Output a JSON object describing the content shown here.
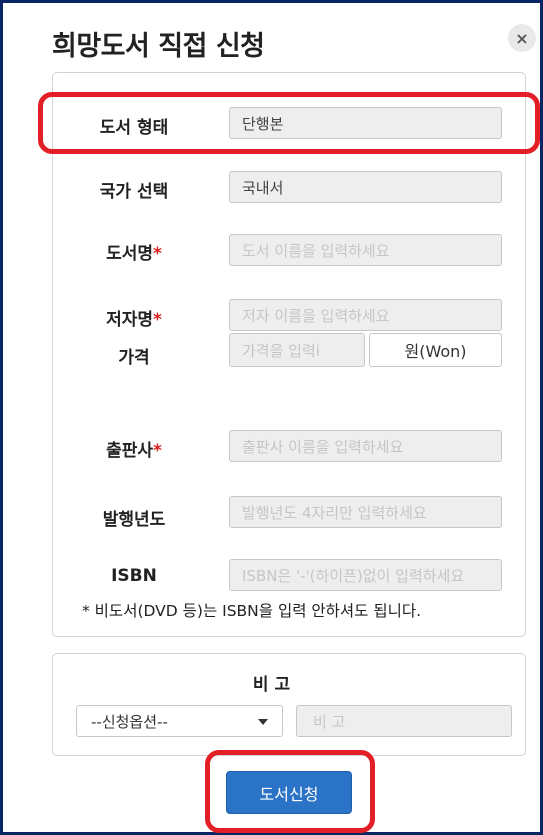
{
  "dialog": {
    "title": "희망도서 직접 신청",
    "close_label": "×"
  },
  "form": {
    "rows": [
      {
        "label": "도서 형태",
        "required": false,
        "value": "단행본",
        "placeholder": ""
      },
      {
        "label": "국가 선택",
        "required": false,
        "value": "국내서",
        "placeholder": ""
      },
      {
        "label": "도서명",
        "required": true,
        "value": "",
        "placeholder": "도서 이름을 입력하세요"
      },
      {
        "label": "저자명",
        "required": true,
        "value": "",
        "placeholder": "저자 이름을 입력하세요"
      },
      {
        "label": "가격",
        "required": false,
        "value": "",
        "placeholder": "가격을 입력i",
        "unit": "원(Won)"
      },
      {
        "label": "출판사",
        "required": true,
        "value": "",
        "placeholder": "출판사 이름을 입력하세요"
      },
      {
        "label": "발행년도",
        "required": false,
        "value": "",
        "placeholder": "발행년도 4자리만 입력하세요"
      },
      {
        "label": "ISBN",
        "required": false,
        "value": "",
        "placeholder": "ISBN은 '-'(하이픈)없이 입력하세요"
      }
    ],
    "required_mark": "*",
    "note": "* 비도서(DVD 등)는 ISBN을 입력 안하셔도 됩니다."
  },
  "remarks": {
    "label": "비 고",
    "option_selected": "--신청옵션--",
    "input_placeholder": "비 고"
  },
  "submit_label": "도서신청",
  "colors": {
    "highlight": "#e21f26",
    "button": "#2b73c7",
    "frame": "#0a2566",
    "required_star": "#d9201c"
  }
}
